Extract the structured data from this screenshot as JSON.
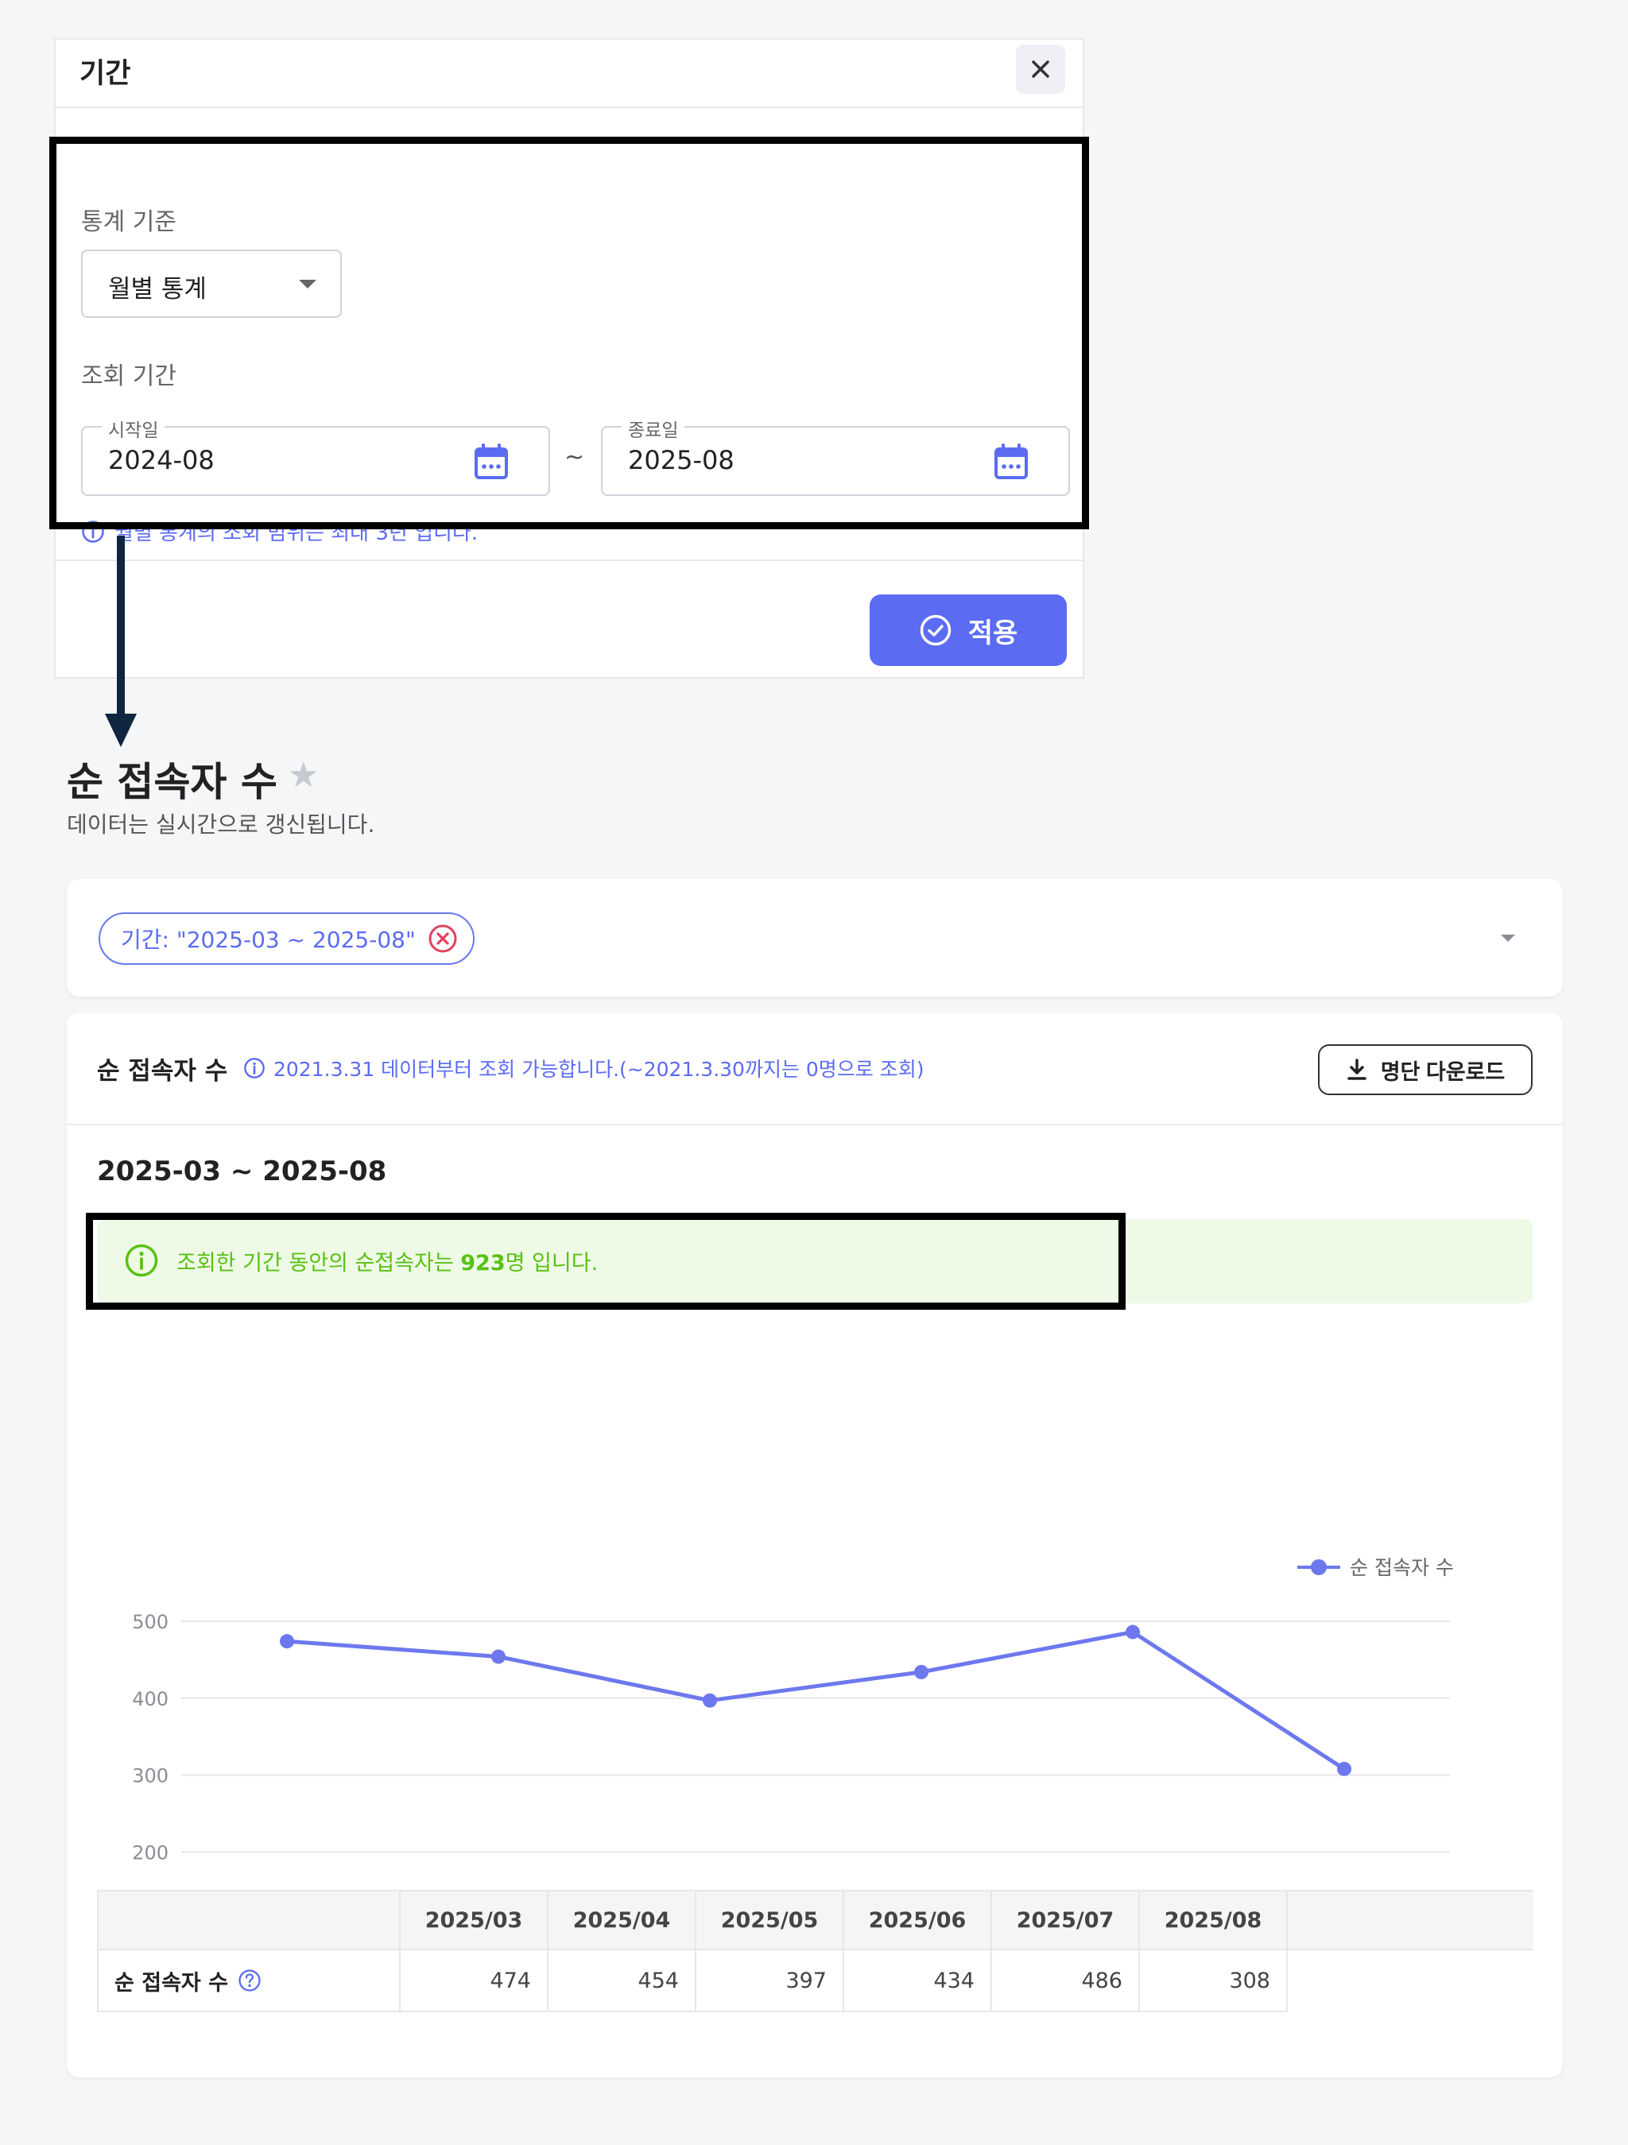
{
  "panel": {
    "title": "기간",
    "stat_basis_label": "통계 기준",
    "stat_basis_value": "월별 통계",
    "period_label": "조회 기간",
    "start_legend": "시작일",
    "start_value": "2024-08",
    "end_legend": "종료일",
    "end_value": "2025-08",
    "tilde": "~",
    "hint": "월별 통계의 조회 범위는 최대 3년 입니다.",
    "apply_label": "적용"
  },
  "page": {
    "title": "순 접속자 수",
    "subtitle": "데이터는 실시간으로 갱신됩니다."
  },
  "filter": {
    "chip_text": "기간: \"2025-03 ~ 2025-08\""
  },
  "card": {
    "title": "순 접속자 수",
    "note": "2021.3.31 데이터부터 조회 가능합니다.(~2021.3.30까지는 0명으로 조회)",
    "download_label": "명단 다운로드",
    "range_title": "2025-03 ~ 2025-08",
    "banner_prefix": "조회한 기간 동안의 순접속자는 ",
    "banner_value": "923",
    "banner_suffix": "명 입니다."
  },
  "colors": {
    "accent": "#5b6bf2",
    "line": "#6d78ee",
    "success": "#58c212",
    "danger": "#e0435e"
  },
  "chart_data": {
    "type": "line",
    "categories": [
      "2025/03",
      "2025/04",
      "2025/05",
      "2025/06",
      "2025/07",
      "2025/08"
    ],
    "series": [
      {
        "name": "순 접속자 수",
        "values": [
          474,
          454,
          397,
          434,
          486,
          308
        ]
      }
    ],
    "yticks": [
      "0",
      "100",
      "200",
      "300",
      "400",
      "500"
    ],
    "ylim": [
      0,
      500
    ],
    "grid": true,
    "legend": "top-right"
  },
  "table": {
    "headers": [
      "2025/03",
      "2025/04",
      "2025/05",
      "2025/06",
      "2025/07",
      "2025/08"
    ],
    "row_label": "순 접속자 수",
    "values": [
      "474",
      "454",
      "397",
      "434",
      "486",
      "308"
    ]
  }
}
